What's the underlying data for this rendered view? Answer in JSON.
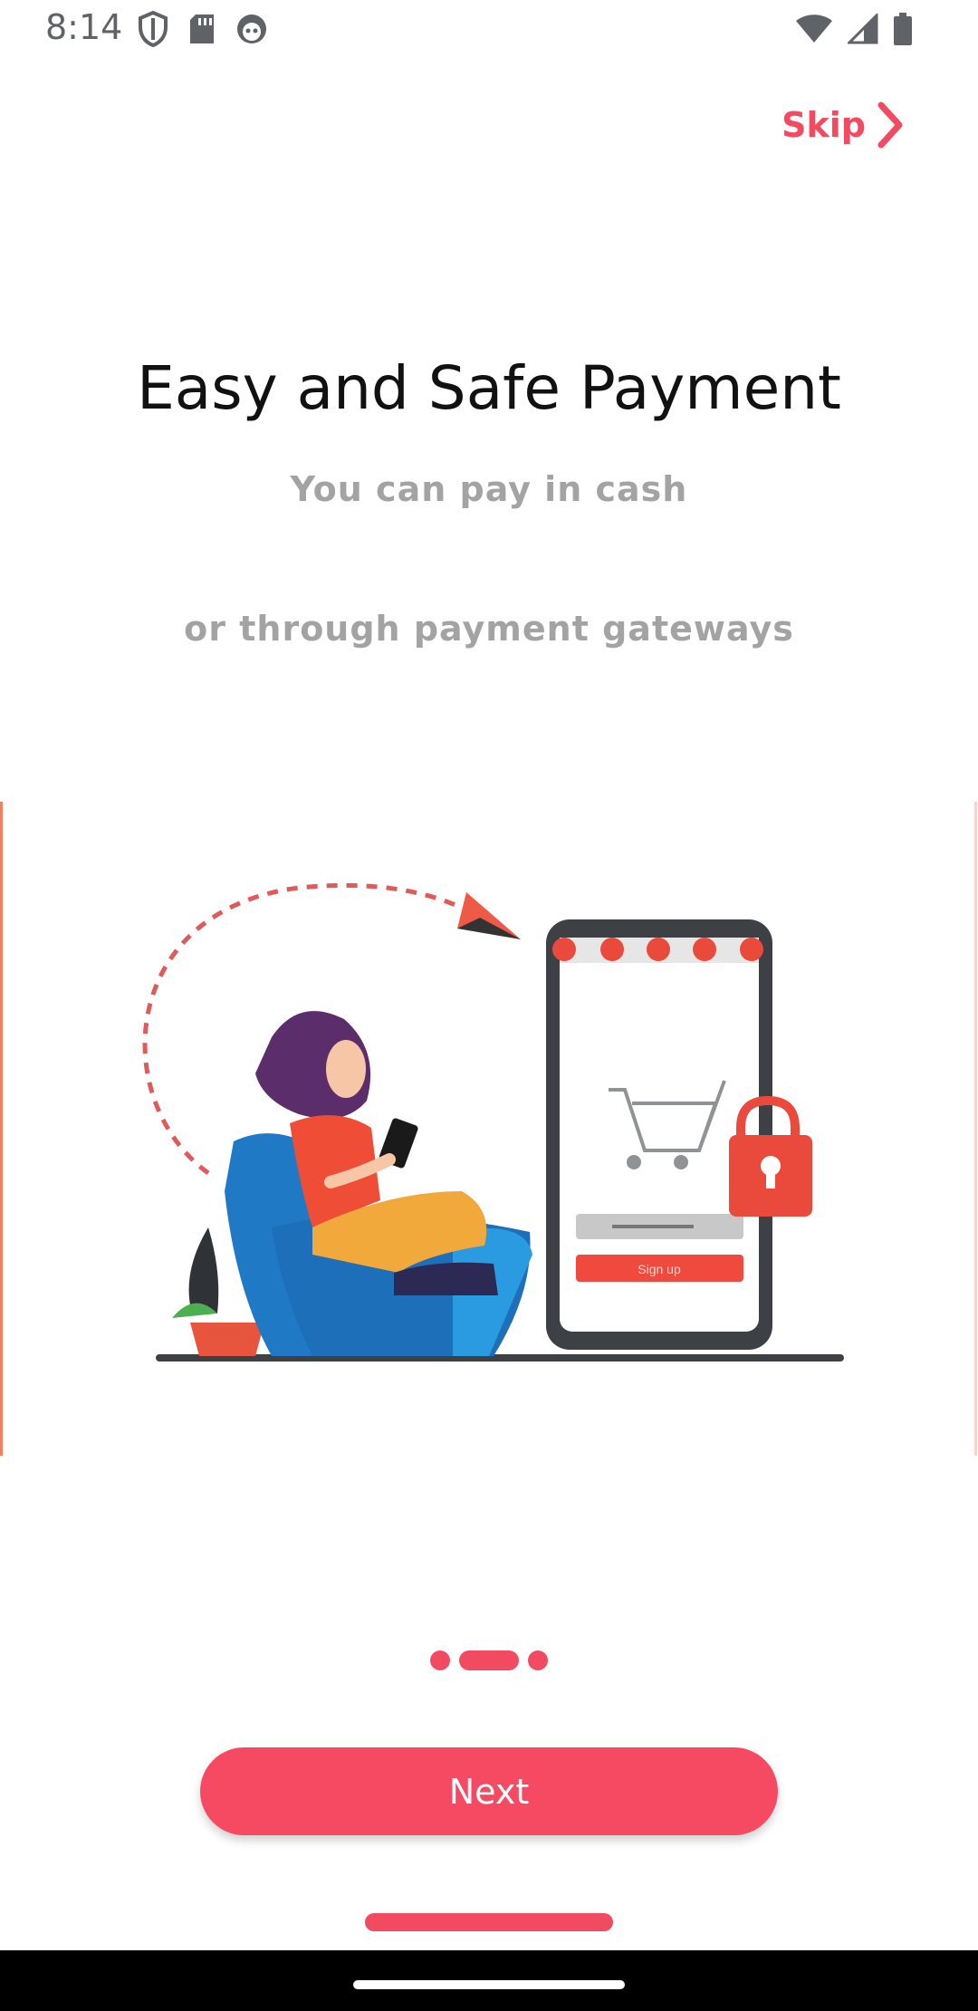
{
  "status_bar": {
    "time": "8:14",
    "left_icons": [
      "shield-icon",
      "sd-card-icon",
      "face-icon"
    ],
    "right_icons": [
      "wifi-icon",
      "cellular-signal-icon",
      "battery-icon"
    ]
  },
  "header": {
    "skip_label": "Skip"
  },
  "content": {
    "title": "Easy and Safe Payment",
    "subtitle_line1": "You can pay in cash",
    "subtitle_line2": "or through payment gateways",
    "illustration_button_text": "Sign up"
  },
  "pager": {
    "page_count": 3,
    "active_index": 1
  },
  "actions": {
    "next_label": "Next"
  },
  "colors": {
    "accent": "#f24a60",
    "button": "#f64a62",
    "title": "#111111",
    "subtitle": "#a3a3a3"
  }
}
